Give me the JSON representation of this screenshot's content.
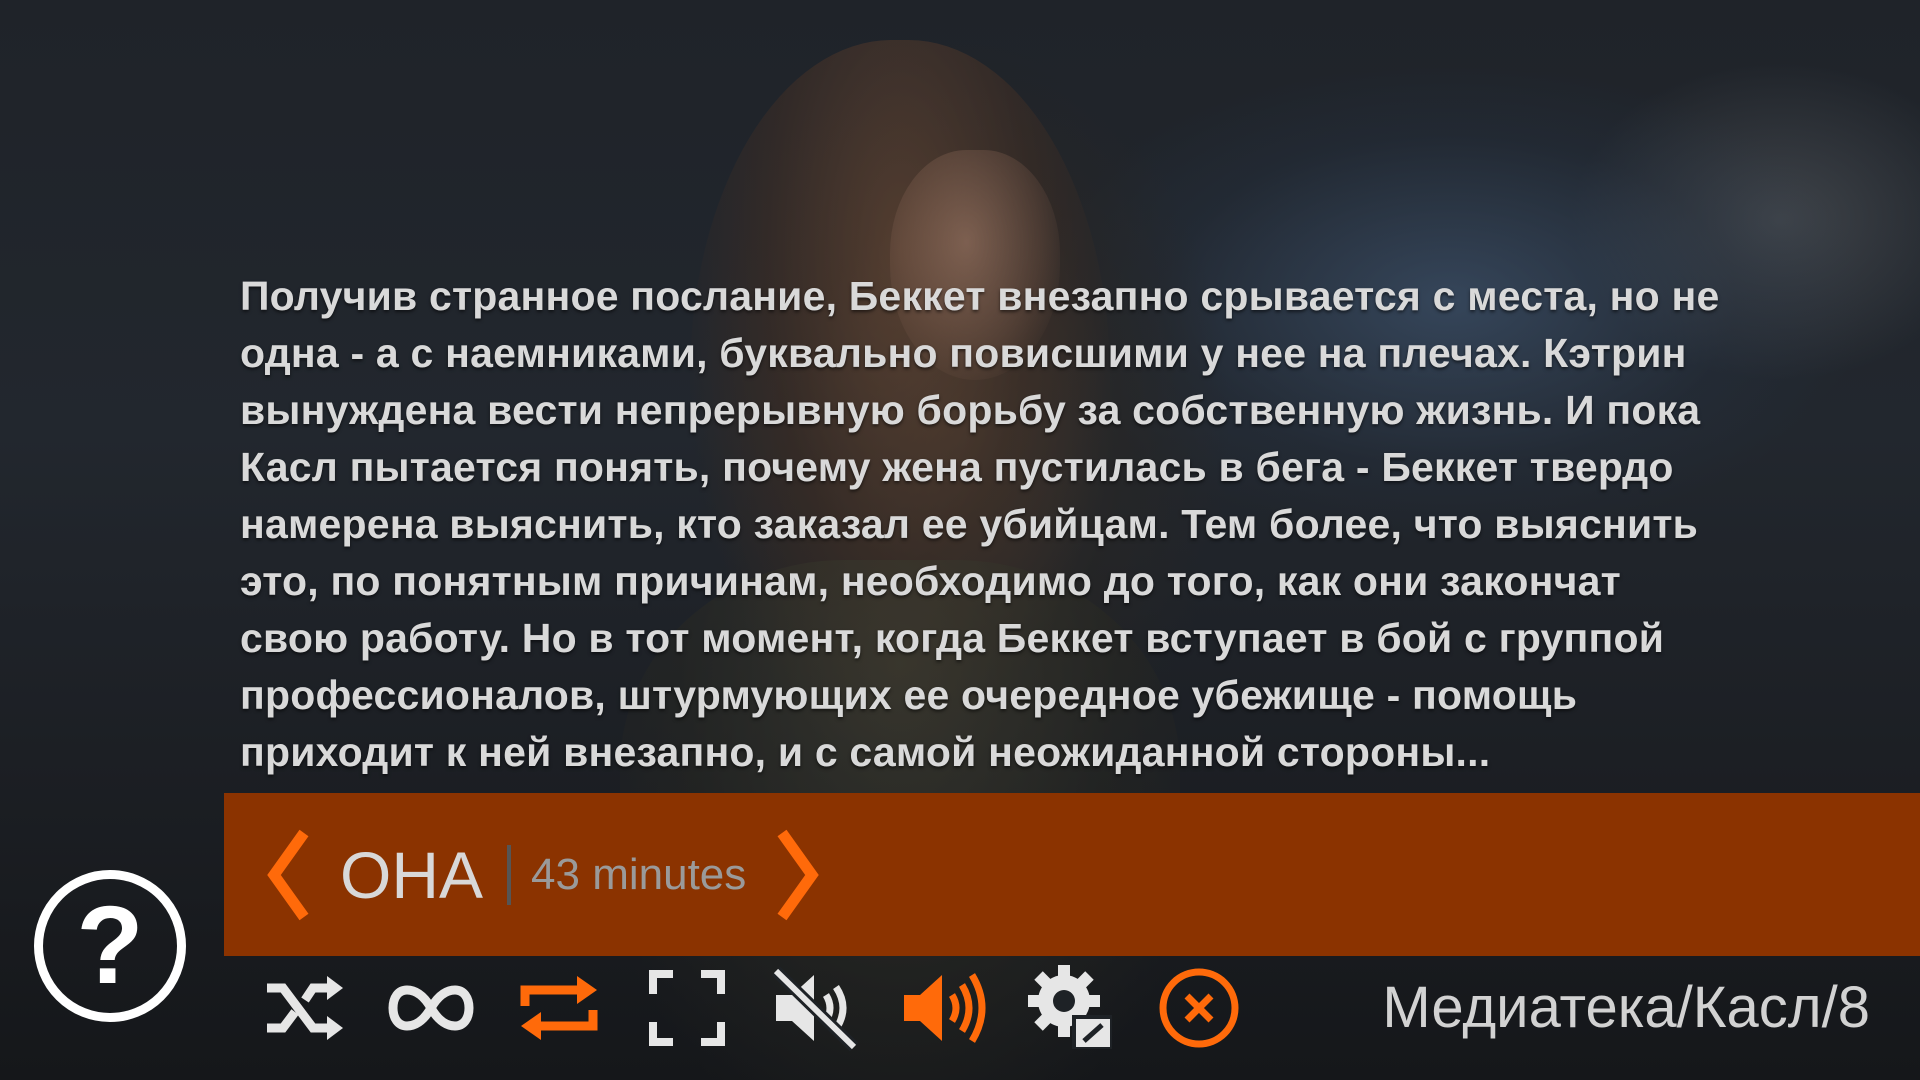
{
  "description": "Получив странное послание, Беккет внезапно срывается с места, но не\nодна - а с наемниками, буквально повисшими у нее на плечах. Кэтрин\nвынуждена вести непрерывную борьбу за собственную жизнь. И пока\nКасл пытается понять, почему жена пустилась в бега - Беккет твердо\nнамерена выяснить, кто заказал ее убийцам. Тем более, что выяснить\nэто, по понятным причинам, необходимо до того, как они закончат\nсвою работу. Но в тот момент, когда Беккет вступает в бой с группой\nпрофессионалов, штурмующих ее очередное убежище - помощь\nприходит к ней внезапно, и с самой неожиданной стороны...",
  "episode": {
    "title": "ОНА",
    "duration": "43 minutes"
  },
  "help": {
    "symbol": "?"
  },
  "toolbar": {
    "buttons": [
      {
        "icon": "shuffle-icon",
        "active": false
      },
      {
        "icon": "infinity-icon",
        "active": false
      },
      {
        "icon": "repeat-icon",
        "active": true
      },
      {
        "icon": "fullscreen-icon",
        "active": false
      },
      {
        "icon": "volume-muted-icon",
        "active": false
      },
      {
        "icon": "volume-up-icon",
        "active": true
      },
      {
        "icon": "settings-icon",
        "active": false
      },
      {
        "icon": "close-icon",
        "active": true
      }
    ]
  },
  "breadcrumb": "Медиатека/Касл/8",
  "colors": {
    "accent": "#ff6a0a",
    "title_bar": "#8b3300",
    "icon_default": "#e6e6e6",
    "text": "#d9d9d9"
  }
}
